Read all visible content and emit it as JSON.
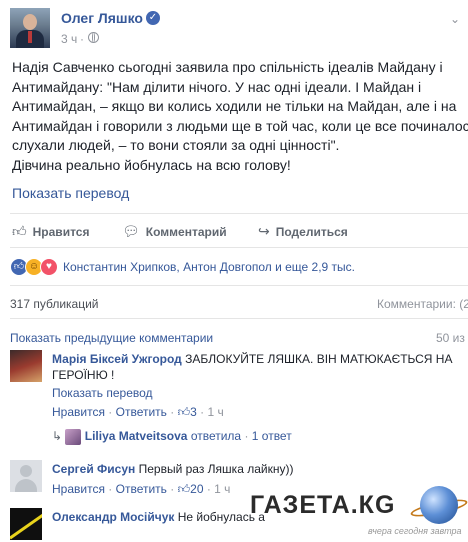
{
  "post": {
    "author": "Олег Ляшко",
    "verified_icon": "verified-checkmark-icon",
    "time": "3 ч",
    "menu_icon": "chevron-down-icon",
    "text": "Надія Савченко сьогодні заявила про спільність ідеалів Майдану і\nАнтимайдану: \"Нам ділити нічого. У нас одні ідеали. І Майдан і\nАнтимайдан, – якщо ви колись ходили не тільки на Майдан, але і на\nАнтимайдан і говорили з людьми ще в той час, коли це все починалось,\nслухали людей, – то вони стояли за одні цінності\".\nДівчина реально йобнулась на всю голову!",
    "translate_label": "Показать перевод"
  },
  "actions": {
    "like": "Нравится",
    "comment": "Комментарий",
    "share": "Поделиться"
  },
  "reactions": {
    "icons": [
      "like-reaction-icon",
      "haha-reaction-icon",
      "love-reaction-icon"
    ],
    "summary": "Константин Хрипков, Антон Довгопол и еще 2,9 тыс."
  },
  "stats": {
    "publications": "317 публикаций",
    "comments": "Комментарии: (2"
  },
  "comments_header": {
    "previous": "Показать предыдущие комментарии",
    "count": "50 из"
  },
  "comments": [
    {
      "author": "Марія Біксей Ужгород",
      "text": "ЗАБЛОКУЙТЕ ЛЯШКА. ВІН МАТЮКАЄТЬСЯ НА ГЕРОЇНЮ !",
      "translate": "Показать перевод",
      "like": "Нравится",
      "reply": "Ответить",
      "likes": "3",
      "time": "1 ч",
      "reply_author": "Liliya Matveitsova",
      "reply_action": "ответила",
      "reply_count": "1 ответ"
    },
    {
      "author": "Сергей Фисун",
      "text": "Первый раз Ляшка лайкну))",
      "like": "Нравится",
      "reply": "Ответить",
      "likes": "20",
      "time": "1 ч"
    },
    {
      "author": "Олександр Мосійчук",
      "text": "Не йобнулась а"
    }
  ],
  "watermark": {
    "logo": "ГАЗЕТА.КG",
    "tagline": "вчера сегодня завтра"
  },
  "colors": {
    "link": "#365899",
    "muted": "#90949c",
    "divider": "#e5e5e5",
    "accent": "#4267b2"
  }
}
